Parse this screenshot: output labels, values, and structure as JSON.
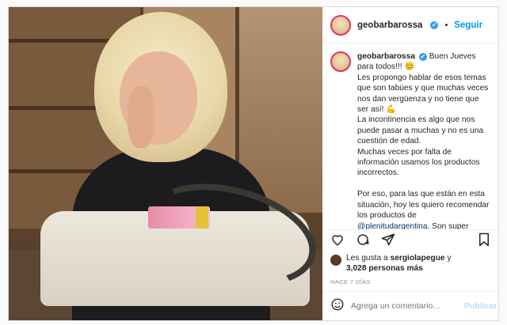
{
  "post": {
    "username": "geobarbarossa",
    "verified_glyph": "✔",
    "separator": "•",
    "follow_label": "Seguir",
    "caption_lines": [
      "Buen Jueves para todos!!! 😊",
      "Les propongo hablar de esos temas que son tabúes y que muchas veces nos dan vergüenza y no tiene que ser así! 💪",
      "La incontinencia es algo que nos puede pasar a muchas y no es una cuestión de edad.",
      "Muchas veces por falta de información usamos los productos incorrectos.",
      "Por eso, para las que están en esta situación, hoy les quiero recomendar los productos de",
      "@plenitudargentina",
      ". Son super prácticos y cómodos para llevar en la cartera y estar protegidas siempre."
    ],
    "likes_prefix": "Les gusta a",
    "likes_user": "sergiolapegue",
    "likes_and": "y",
    "likes_count": "3,028 personas más",
    "time_ago": "HACE 7 DÍAS",
    "comment_placeholder": "Agrega un comentario...",
    "publish_label": "Publicar",
    "icons": [
      "heart-icon",
      "comment-icon",
      "share-icon",
      "bookmark-icon",
      "emoji-icon"
    ]
  }
}
